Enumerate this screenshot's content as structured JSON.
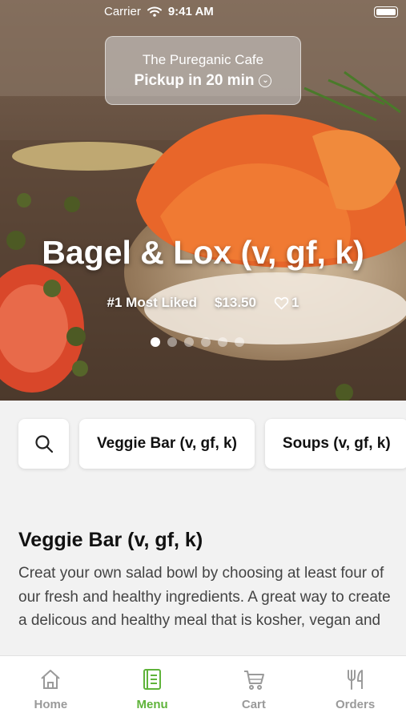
{
  "status_bar": {
    "carrier": "Carrier",
    "time": "9:41 AM"
  },
  "pickup": {
    "restaurant": "The Pureganic Cafe",
    "time_label": "Pickup in 20 min",
    "chevron": "⌄"
  },
  "hero": {
    "item_title": "Bagel & Lox (v, gf, k)",
    "rank": "#1 Most Liked",
    "price": "$13.50",
    "likes": "1",
    "pages": 6,
    "current_page": 1
  },
  "categories": [
    {
      "label": "Veggie Bar (v, gf, k)"
    },
    {
      "label": "Soups (v, gf, k)"
    }
  ],
  "section": {
    "title": "Veggie Bar (v, gf, k)",
    "description": "Creat your own salad bowl by choosing at least four of our fresh and healthy ingredients. A great way to create a delicous and healthy meal that is kosher, vegan and"
  },
  "tabs": [
    {
      "label": "Home",
      "icon": "home-icon"
    },
    {
      "label": "Menu",
      "icon": "menu-book-icon",
      "active": true
    },
    {
      "label": "Cart",
      "icon": "cart-icon"
    },
    {
      "label": "Orders",
      "icon": "fork-knife-icon"
    }
  ],
  "colors": {
    "accent": "#5fb33a",
    "inactive": "#9a9a9a"
  }
}
